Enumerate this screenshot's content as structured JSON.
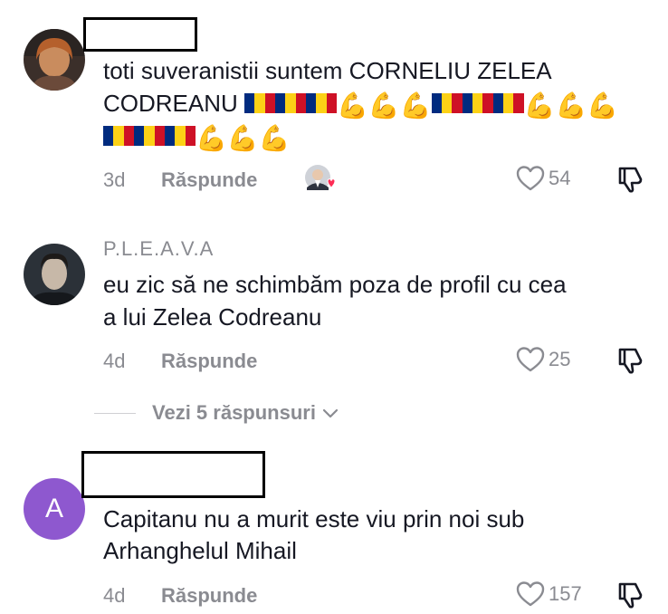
{
  "comments": [
    {
      "username": "",
      "text_line1": "toti suveranistii suntem CORNELIU ZELEA",
      "text_line2_prefix": "CODREANU",
      "time": "3d",
      "reply_label": "Răspunde",
      "likes": "54"
    },
    {
      "username": "P.L.E.A.V.A",
      "text_line1": "eu zic să ne schimbăm poza de profil cu cea",
      "text_line2": "a lui Zelea Codreanu",
      "time": "4d",
      "reply_label": "Răspunde",
      "likes": "25"
    },
    {
      "username": "",
      "avatar_letter": "A",
      "text_line1": "Capitanu nu a murit este viu prin noi sub",
      "text_line2": "Arhanghelul Mihail",
      "time": "4d",
      "reply_label": "Răspunde",
      "likes": "157"
    }
  ],
  "view_replies": {
    "label": "Vezi 5 răspunsuri"
  },
  "icons": {
    "emoji_flex": "💪",
    "heart": "heart-outline-icon",
    "dislike": "thumbs-down-icon",
    "chevron": "chevron-down-icon"
  },
  "colors": {
    "flag_blue": "#002B7F",
    "flag_yellow": "#FCD116",
    "flag_red": "#CE1126",
    "avatar_purple": "#8e58cf",
    "muted": "#8a8b91"
  }
}
